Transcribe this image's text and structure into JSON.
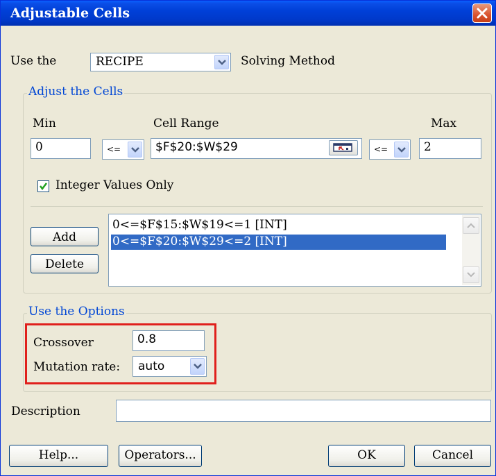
{
  "window": {
    "title": "Adjustable Cells"
  },
  "method": {
    "prefix": "Use the",
    "value": "RECIPE",
    "suffix": "Solving Method"
  },
  "adjust_group": {
    "title": "Adjust the Cells",
    "min_label": "Min",
    "range_label": "Cell Range",
    "max_label": "Max",
    "min_value": "0",
    "min_operator": "<=",
    "range_value": "$F$20:$W$29",
    "max_operator": "<=",
    "max_value": "2",
    "integer_label": "Integer Values Only",
    "integer_checked": true
  },
  "constraints": {
    "add_label": "Add",
    "delete_label": "Delete",
    "items": [
      "0<=$F$15:$W$19<=1 [INT]",
      "0<=$F$20:$W$29<=2 [INT]"
    ],
    "selected_index": 1
  },
  "options_group": {
    "title": "Use the Options",
    "crossover_label": "Crossover",
    "crossover_value": "0.8",
    "mutation_label": "Mutation rate:",
    "mutation_value": "auto"
  },
  "description": {
    "label": "Description",
    "value": ""
  },
  "footer": {
    "help_label": "Help...",
    "operators_label": "Operators...",
    "ok_label": "OK",
    "cancel_label": "Cancel"
  },
  "colors": {
    "highlight": "#e0201c",
    "selection": "#316ac5",
    "group_title": "#0046d5"
  }
}
